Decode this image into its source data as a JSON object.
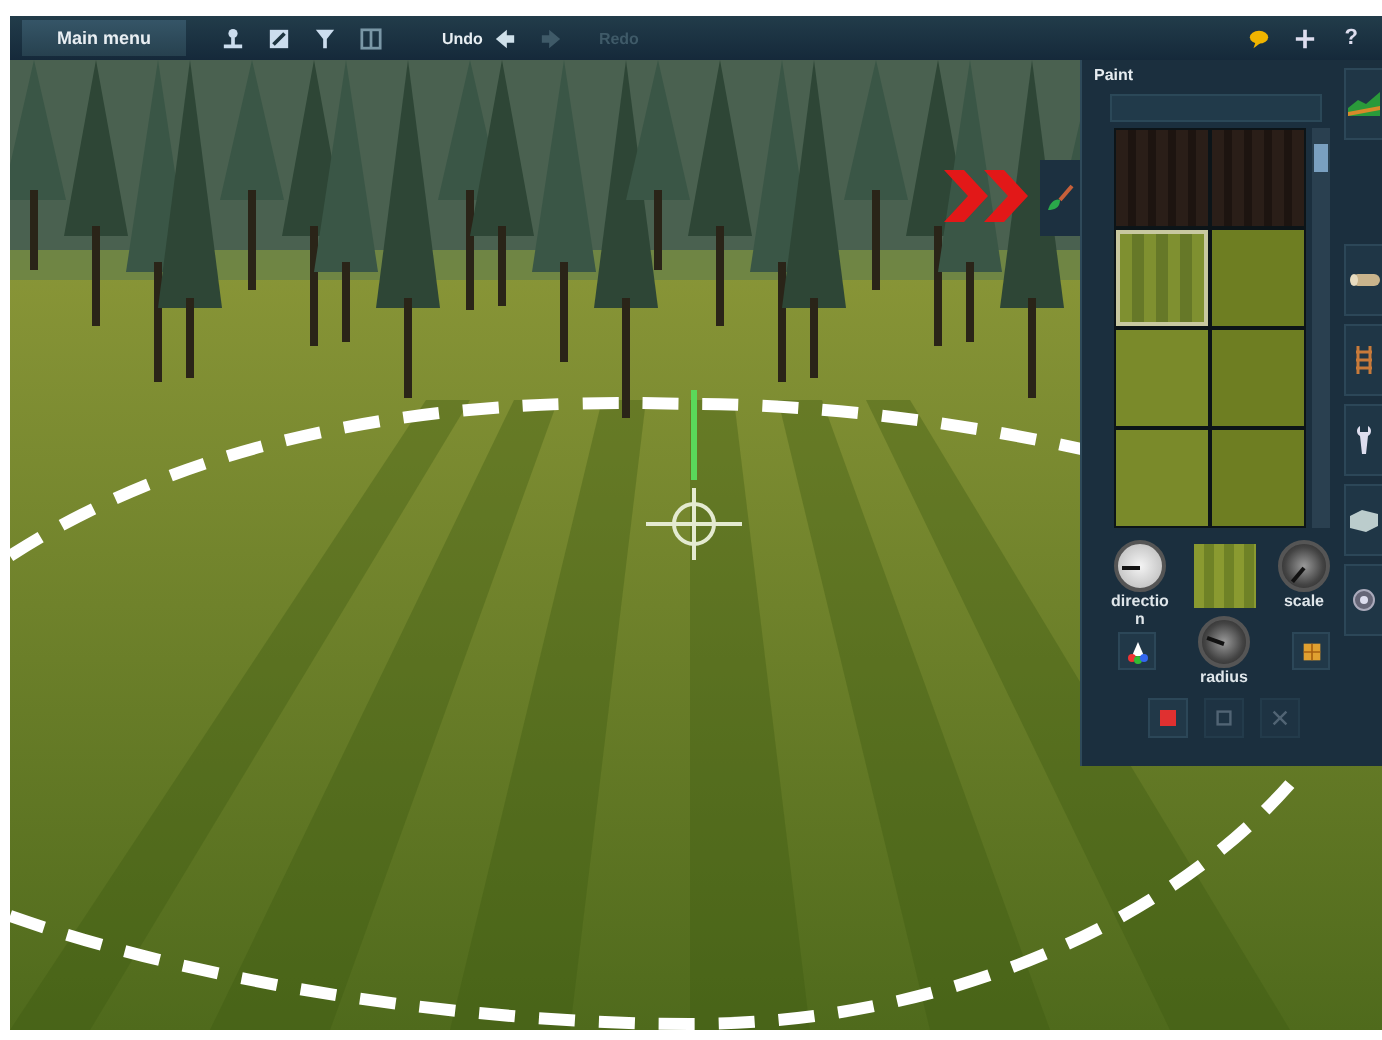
{
  "toolbar": {
    "main_menu": "Main menu",
    "undo": {
      "label": "Undo",
      "disabled": false
    },
    "redo": {
      "label": "Redo",
      "disabled": true
    },
    "help": "?"
  },
  "side_tab": {
    "selected": true
  },
  "paint_panel": {
    "title": "Paint",
    "tiles": [
      {
        "kind": "bark",
        "selected": false
      },
      {
        "kind": "bark",
        "selected": false
      },
      {
        "kind": "stripes",
        "selected": true
      },
      {
        "kind": "grass",
        "selected": false
      },
      {
        "kind": "grass",
        "selected": false
      },
      {
        "kind": "grass",
        "selected": false
      },
      {
        "kind": "grass",
        "selected": false
      },
      {
        "kind": "grass",
        "selected": false
      }
    ],
    "direction_label": "direction",
    "scale_label": "scale",
    "radius_label": "radius",
    "actions": [
      {
        "kind": "stop",
        "disabled": false
      },
      {
        "kind": "save",
        "disabled": true
      },
      {
        "kind": "close",
        "disabled": true
      }
    ]
  }
}
